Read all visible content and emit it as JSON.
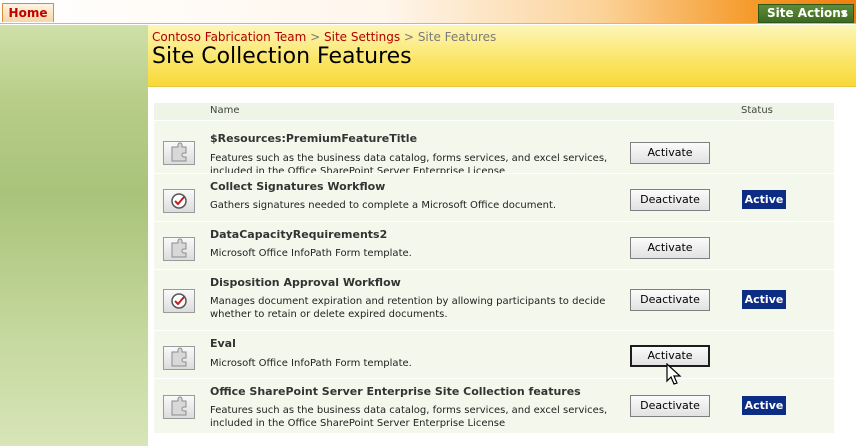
{
  "topbar": {
    "home_label": "Home",
    "site_actions_label": "Site Actions",
    "site_actions_arrow": "▼",
    "site_actions_color": "#4a7a27"
  },
  "breadcrumb": {
    "items": [
      "Contoso Fabrication Team",
      "Site Settings",
      "Site Features"
    ],
    "separator": ">"
  },
  "page_title": "Site Collection Features",
  "table": {
    "col_name": "Name",
    "col_status": "Status"
  },
  "features": [
    {
      "name": "$Resources:PremiumFeatureTitle",
      "description": "Features such as the business data catalog, forms services, and excel services, included in the Office SharePoint Server Enterprise License",
      "button": "Activate",
      "status": "",
      "icon": "puzzle-icon"
    },
    {
      "name": "Collect Signatures Workflow",
      "description": "Gathers signatures needed to complete a Microsoft Office document.",
      "button": "Deactivate",
      "status": "Active",
      "icon": "workflow-icon"
    },
    {
      "name": "DataCapacityRequirements2",
      "description": "Microsoft Office InfoPath Form template.",
      "button": "Activate",
      "status": "",
      "icon": "puzzle-icon"
    },
    {
      "name": "Disposition Approval Workflow",
      "description": "Manages document expiration and retention by allowing participants to decide whether to retain or delete expired documents.",
      "button": "Deactivate",
      "status": "Active",
      "icon": "workflow-icon"
    },
    {
      "name": "Eval",
      "description": "Microsoft Office InfoPath Form template.",
      "button": "Activate",
      "status": "",
      "icon": "puzzle-icon"
    },
    {
      "name": "Office SharePoint Server Enterprise Site Collection features",
      "description": "Features such as the business data catalog, forms services, and excel services, included in the Office SharePoint Server Enterprise License",
      "button": "Deactivate",
      "status": "Active",
      "icon": "puzzle-icon"
    }
  ],
  "colors": {
    "active_badge": "#0c2d83",
    "breadcrumb_link": "#b00000",
    "row_background": "#f4f8ec"
  }
}
